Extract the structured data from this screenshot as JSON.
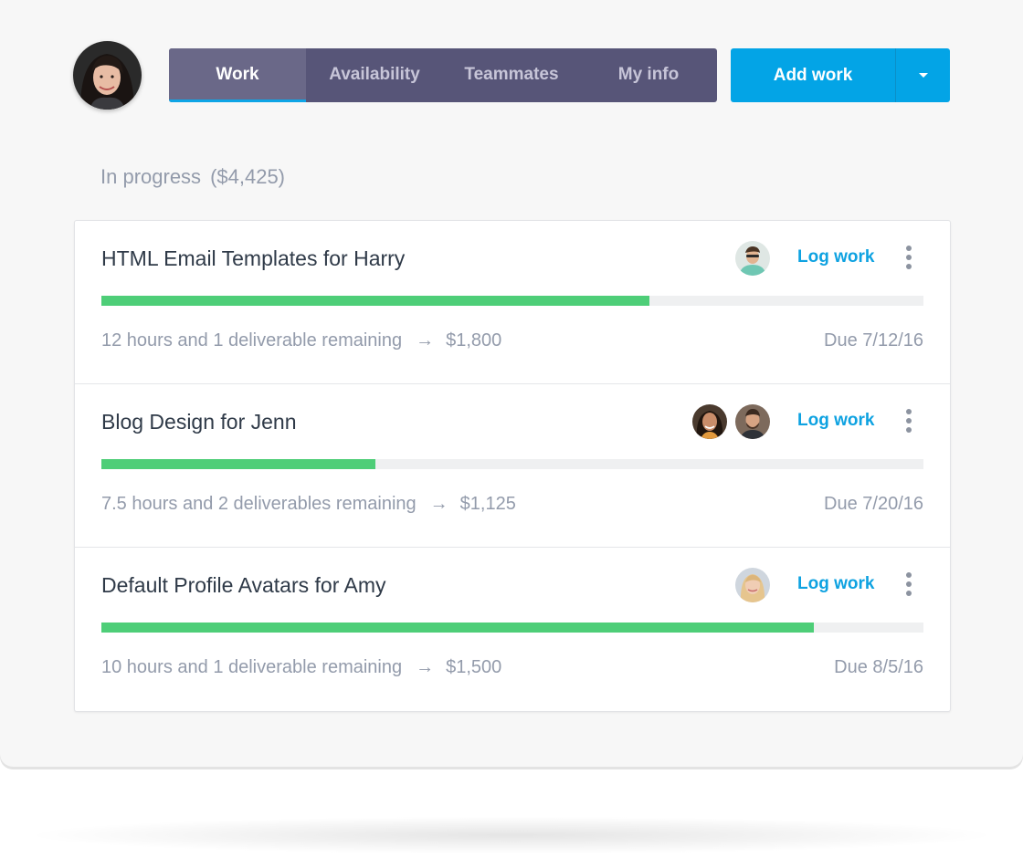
{
  "nav": {
    "tabs": [
      {
        "label": "Work",
        "active": true
      },
      {
        "label": "Availability",
        "active": false
      },
      {
        "label": "Teammates",
        "active": false
      },
      {
        "label": "My info",
        "active": false
      }
    ],
    "add_work_label": "Add work",
    "dropdown_icon": "caret-down-icon"
  },
  "section": {
    "title": "In progress",
    "total": "($4,425)"
  },
  "projects": [
    {
      "title": "HTML Email Templates for Harry",
      "log_label": "Log work",
      "progress": 0.667,
      "remaining": "12 hours and 1 deliverable remaining",
      "arrow": "→",
      "amount": "$1,800",
      "due": "Due 7/12/16"
    },
    {
      "title": "Blog Design for Jenn",
      "log_label": "Log work",
      "progress": 0.333,
      "remaining": "7.5 hours and 2 deliverables remaining",
      "arrow": "→",
      "amount": "$1,125",
      "due": "Due 7/20/16"
    },
    {
      "title": "Default Profile Avatars for Amy",
      "log_label": "Log work",
      "progress": 0.867,
      "remaining": "10 hours and 1 deliverable remaining",
      "arrow": "→",
      "amount": "$1,500",
      "due": "Due 8/5/16"
    }
  ],
  "colors": {
    "tab_bar": "#575578",
    "accent_blue": "#03a4e6",
    "progress_green": "#4ece78",
    "link_blue": "#0ea2e1"
  }
}
